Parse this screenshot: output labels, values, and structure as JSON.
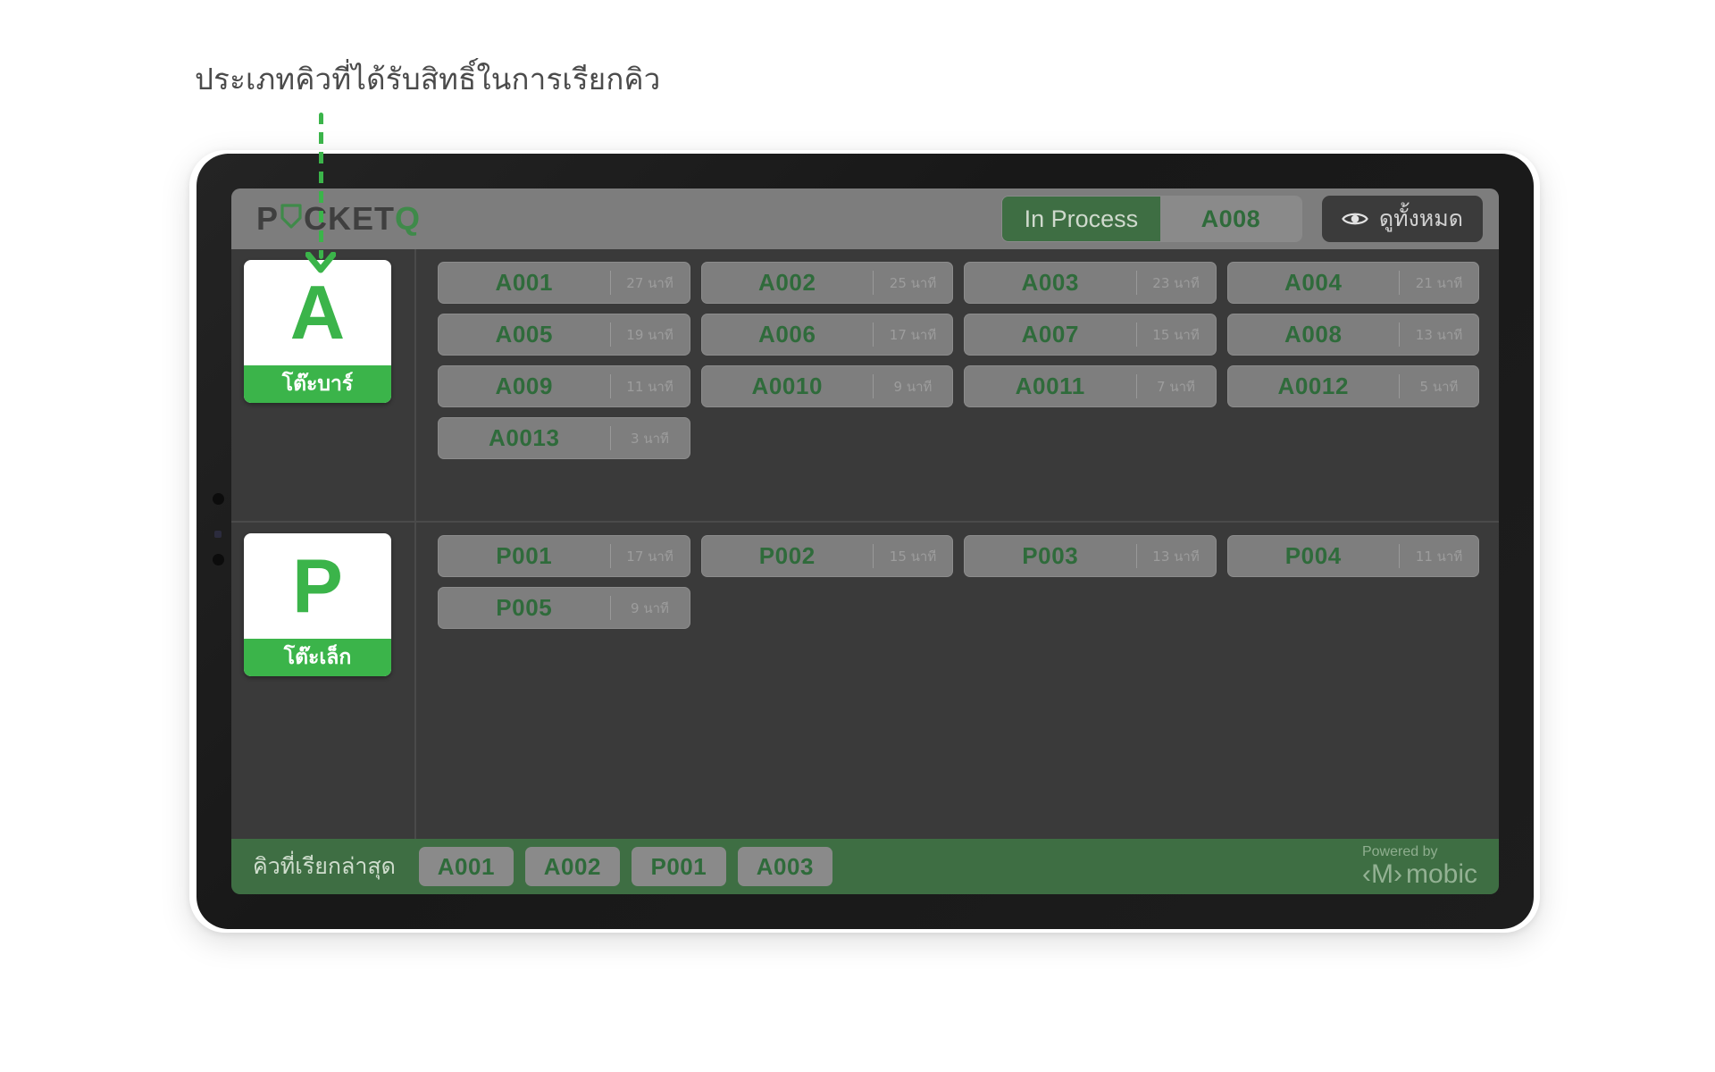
{
  "annotation": {
    "title": "ประเภทคิวที่ได้รับสิทธิ์ในการเรียกคิว",
    "line_color": "#3bb44a",
    "arrow_icon": "down-arrow-icon"
  },
  "header": {
    "logo_text_left": "P",
    "logo_shield_icon": "shield-o-icon",
    "logo_text_mid": "CKET",
    "logo_text_q": "Q",
    "status": {
      "label": "In Process",
      "value": "A008"
    },
    "view_all": {
      "icon": "eye-icon",
      "label": "ดูทั้งหมด"
    }
  },
  "categories": [
    {
      "letter": "A",
      "name": "โต๊ะบาร์",
      "time_unit": "นาที",
      "queues": [
        {
          "code": "A001",
          "time": "27 นาที"
        },
        {
          "code": "A002",
          "time": "25 นาที"
        },
        {
          "code": "A003",
          "time": "23 นาที"
        },
        {
          "code": "A004",
          "time": "21 นาที"
        },
        {
          "code": "A005",
          "time": "19 นาที"
        },
        {
          "code": "A006",
          "time": "17 นาที"
        },
        {
          "code": "A007",
          "time": "15 นาที"
        },
        {
          "code": "A008",
          "time": "13 นาที"
        },
        {
          "code": "A009",
          "time": "11 นาที"
        },
        {
          "code": "A0010",
          "time": "9 นาที"
        },
        {
          "code": "A0011",
          "time": "7 นาที"
        },
        {
          "code": "A0012",
          "time": "5 นาที"
        },
        {
          "code": "A0013",
          "time": "3 นาที"
        }
      ]
    },
    {
      "letter": "P",
      "name": "โต๊ะเล็ก",
      "time_unit": "นาที",
      "queues": [
        {
          "code": "P001",
          "time": "17 นาที"
        },
        {
          "code": "P002",
          "time": "15 นาที"
        },
        {
          "code": "P003",
          "time": "13 นาที"
        },
        {
          "code": "P004",
          "time": "11 นาที"
        },
        {
          "code": "P005",
          "time": "9 นาที"
        }
      ]
    }
  ],
  "footer": {
    "label": "คิวที่เรียกล่าสุด",
    "recent": [
      "A001",
      "A002",
      "P001",
      "A003"
    ],
    "powered_by": "Powered by",
    "brand_mark": "‹M›",
    "brand_name": "mobic"
  },
  "colors": {
    "green": "#3bb44a",
    "dark_green": "#3e6e43",
    "code_green": "#2f6b3b",
    "screen_bg": "#3a3a3a",
    "header_bg": "#7d7d7d",
    "chip_bg": "#7e7e7e"
  }
}
